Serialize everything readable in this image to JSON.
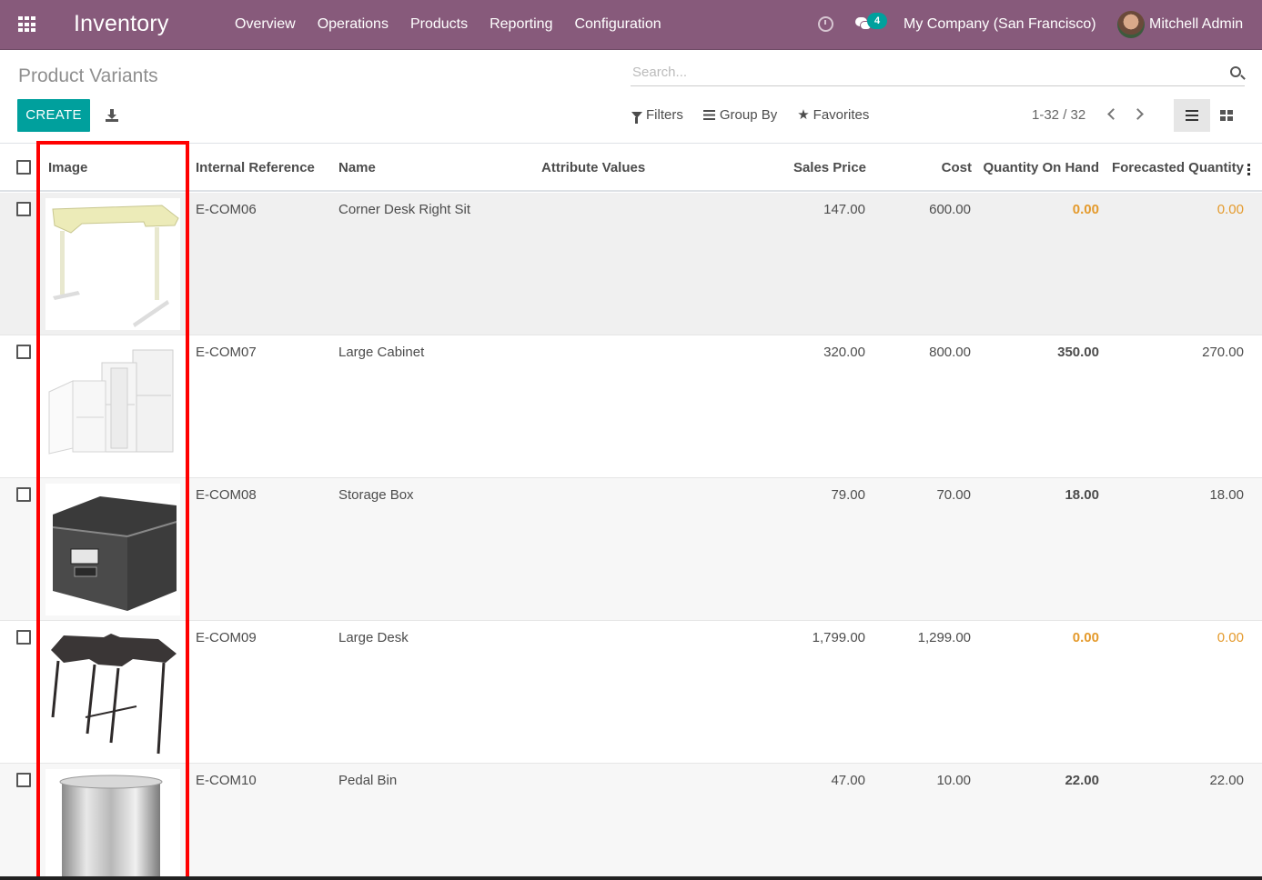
{
  "navbar": {
    "brand": "Inventory",
    "menu": [
      "Overview",
      "Operations",
      "Products",
      "Reporting",
      "Configuration"
    ],
    "chat_count": "4",
    "company": "My Company (San Francisco)",
    "user": "Mitchell Admin"
  },
  "control": {
    "title": "Product Variants",
    "search_placeholder": "Search...",
    "create_label": "CREATE",
    "filters_label": "Filters",
    "groupby_label": "Group By",
    "favorites_label": "Favorites",
    "pager": "1-32 / 32"
  },
  "table": {
    "headers": {
      "image": "Image",
      "internal_ref": "Internal Reference",
      "name": "Name",
      "attributes": "Attribute Values",
      "sales_price": "Sales Price",
      "cost": "Cost",
      "qty_on_hand": "Quantity On Hand",
      "forecasted": "Forecasted Quantity"
    },
    "rows": [
      {
        "ref": "E-COM06",
        "name": "Corner Desk Right Sit",
        "attributes": "",
        "price": "147.00",
        "cost": "600.00",
        "qty": "0.00",
        "forecast": "0.00",
        "image": "corner-desk"
      },
      {
        "ref": "E-COM07",
        "name": "Large Cabinet",
        "attributes": "",
        "price": "320.00",
        "cost": "800.00",
        "qty": "350.00",
        "forecast": "270.00",
        "image": "cabinet"
      },
      {
        "ref": "E-COM08",
        "name": "Storage Box",
        "attributes": "",
        "price": "79.00",
        "cost": "70.00",
        "qty": "18.00",
        "forecast": "18.00",
        "image": "storage-box"
      },
      {
        "ref": "E-COM09",
        "name": "Large Desk",
        "attributes": "",
        "price": "1,799.00",
        "cost": "1,299.00",
        "qty": "0.00",
        "forecast": "0.00",
        "image": "large-desk"
      },
      {
        "ref": "E-COM10",
        "name": "Pedal Bin",
        "attributes": "",
        "price": "47.00",
        "cost": "10.00",
        "qty": "22.00",
        "forecast": "22.00",
        "image": "pedal-bin"
      }
    ]
  },
  "colors": {
    "brand": "#875a7b",
    "primary": "#00a09d",
    "warning": "#e49a2c",
    "highlight": "#ff0000"
  }
}
